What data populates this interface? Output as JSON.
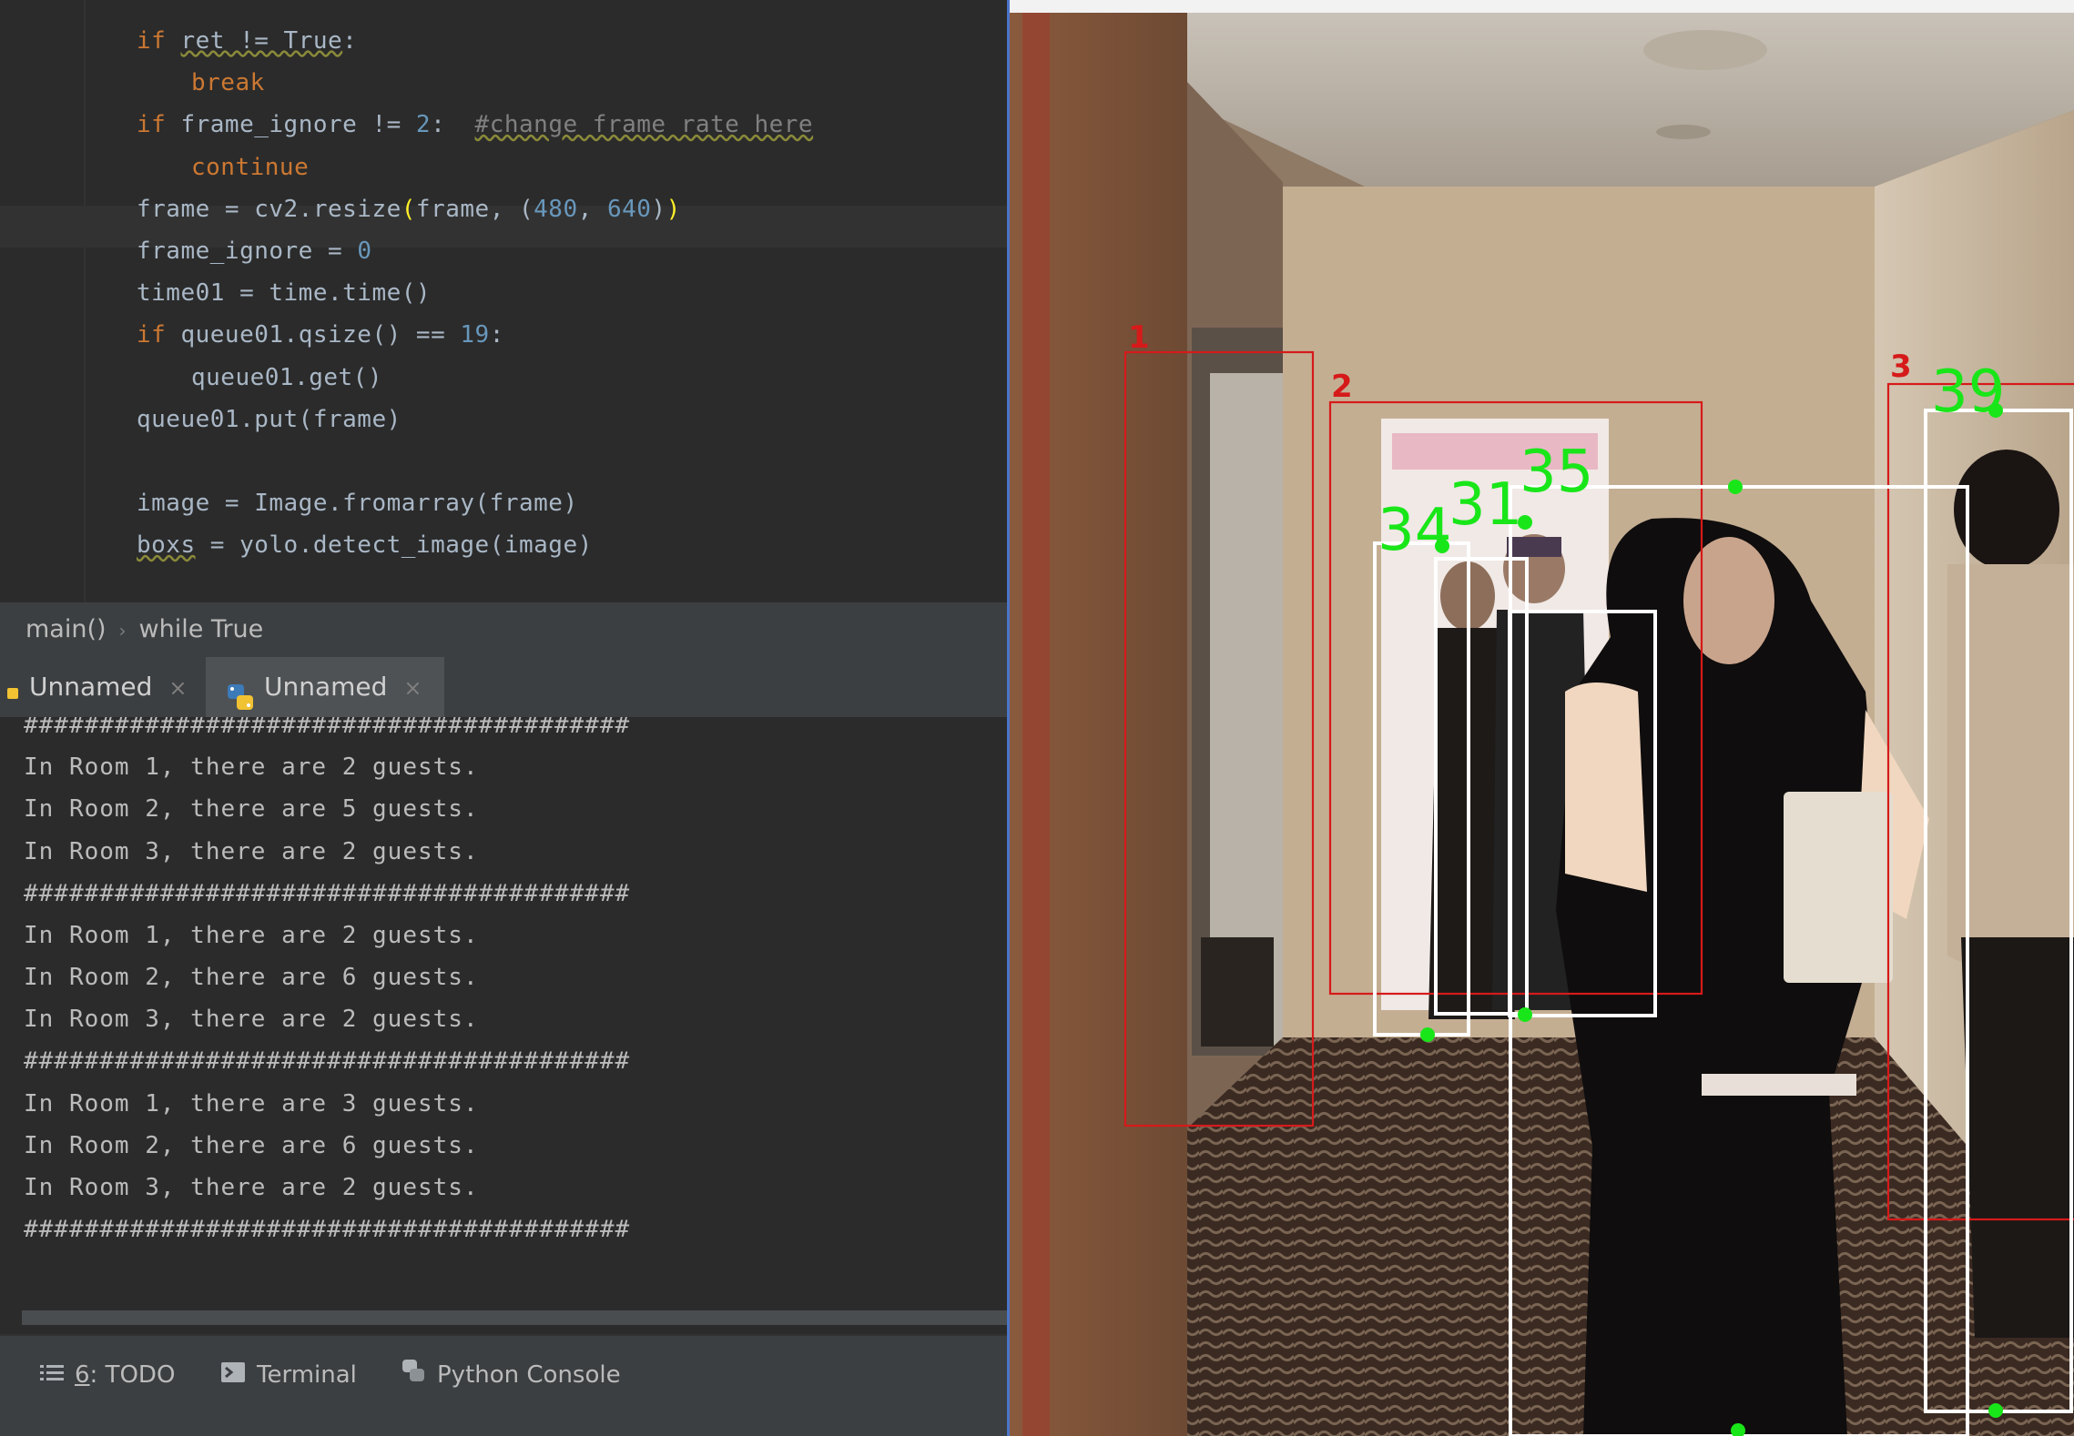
{
  "editor": {
    "lines": [
      {
        "segments": [
          {
            "t": "if ",
            "c": "kw"
          },
          {
            "t": "ret != True",
            "c": "squig"
          },
          {
            "t": ":",
            "c": ""
          }
        ],
        "indent": 1
      },
      {
        "segments": [
          {
            "t": "break",
            "c": "kw"
          }
        ],
        "indent": 2
      },
      {
        "segments": [
          {
            "t": "if ",
            "c": "kw"
          },
          {
            "t": "frame_ignore != ",
            "c": ""
          },
          {
            "t": "2",
            "c": "num"
          },
          {
            "t": ":  ",
            "c": ""
          },
          {
            "t": "#change frame rate here",
            "c": "cmt"
          }
        ],
        "indent": 1
      },
      {
        "segments": [
          {
            "t": "continue",
            "c": "kw"
          }
        ],
        "indent": 2
      },
      {
        "segments": [
          {
            "t": "frame = cv2.resize",
            "c": ""
          },
          {
            "t": "(",
            "c": "paren-hl"
          },
          {
            "t": "frame, (",
            "c": ""
          },
          {
            "t": "480",
            "c": "num"
          },
          {
            "t": ", ",
            "c": ""
          },
          {
            "t": "640",
            "c": "num"
          },
          {
            "t": ")",
            "c": ""
          },
          {
            "t": ")",
            "c": "paren-hl"
          }
        ],
        "indent": 1
      },
      {
        "segments": [
          {
            "t": "frame_ignore = ",
            "c": ""
          },
          {
            "t": "0",
            "c": "num"
          }
        ],
        "indent": 1
      },
      {
        "segments": [
          {
            "t": "time01 = time.time()",
            "c": ""
          }
        ],
        "indent": 1
      },
      {
        "segments": [
          {
            "t": "if ",
            "c": "kw"
          },
          {
            "t": "queue01.qsize() == ",
            "c": ""
          },
          {
            "t": "19",
            "c": "num"
          },
          {
            "t": ":",
            "c": ""
          }
        ],
        "indent": 1
      },
      {
        "segments": [
          {
            "t": "queue01.get()",
            "c": ""
          }
        ],
        "indent": 2
      },
      {
        "segments": [
          {
            "t": "queue01.put(frame)",
            "c": ""
          }
        ],
        "indent": 1
      },
      {
        "segments": [],
        "indent": 1
      },
      {
        "segments": [
          {
            "t": "image = Image.fromarray(frame)",
            "c": ""
          }
        ],
        "indent": 1
      },
      {
        "segments": [
          {
            "t": "boxs",
            "c": "squig"
          },
          {
            "t": " = yolo.detect_image(image)",
            "c": ""
          }
        ],
        "indent": 1
      }
    ]
  },
  "breadcrumb": {
    "fn": "main()",
    "block": "while True"
  },
  "run_tabs": [
    {
      "label": "Unnamed",
      "close": "×"
    },
    {
      "label": "Unnamed",
      "close": "×"
    }
  ],
  "console": {
    "lines": [
      "########################################",
      "In Room 1, there are 2 guests.",
      "In Room 2, there are 5 guests.",
      "In Room 3, there are 2 guests.",
      "########################################",
      "In Room 1, there are 2 guests.",
      "In Room 2, there are 6 guests.",
      "In Room 3, there are 2 guests.",
      "########################################",
      "In Room 1, there are 3 guests.",
      "In Room 2, there are 6 guests.",
      "In Room 3, there are 2 guests.",
      "########################################"
    ]
  },
  "tool_windows": {
    "todo": {
      "num": "6",
      "label": ": TODO"
    },
    "terminal": "Terminal",
    "python_console": "Python Console"
  },
  "video": {
    "room_labels": [
      "1",
      "2",
      "3"
    ],
    "track_ids": [
      "34",
      "31",
      "35",
      "39"
    ],
    "colors": {
      "room_box": "#d61a1a",
      "track_box": "#ffffff",
      "track_id": "#19e619"
    }
  }
}
